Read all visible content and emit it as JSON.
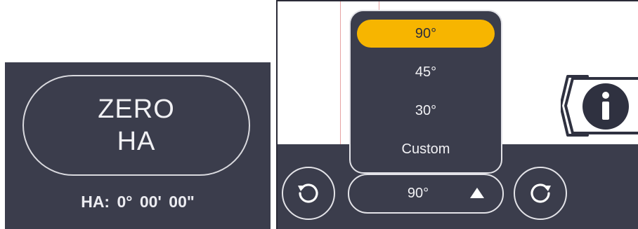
{
  "zero_ha_panel": {
    "button_line1": "ZERO",
    "button_line2": "HA",
    "readout": "HA:  0° 00' 00\""
  },
  "rotation_panel": {
    "angle_select": {
      "value": "90°",
      "options": [
        {
          "label": "90°",
          "selected": true
        },
        {
          "label": "45°",
          "selected": false
        },
        {
          "label": "30°",
          "selected": false
        },
        {
          "label": "Custom",
          "selected": false
        }
      ]
    },
    "icons": {
      "rotate_left": "rotate-ccw-icon",
      "rotate_right": "rotate-cw-icon",
      "caret": "caret-up-icon",
      "info": "info-icon"
    }
  },
  "colors": {
    "panel_bg": "#3b3d4c",
    "accent_selected": "#f7b500",
    "outline": "#e3e3e8",
    "guide_line": "#e7a3a3"
  }
}
